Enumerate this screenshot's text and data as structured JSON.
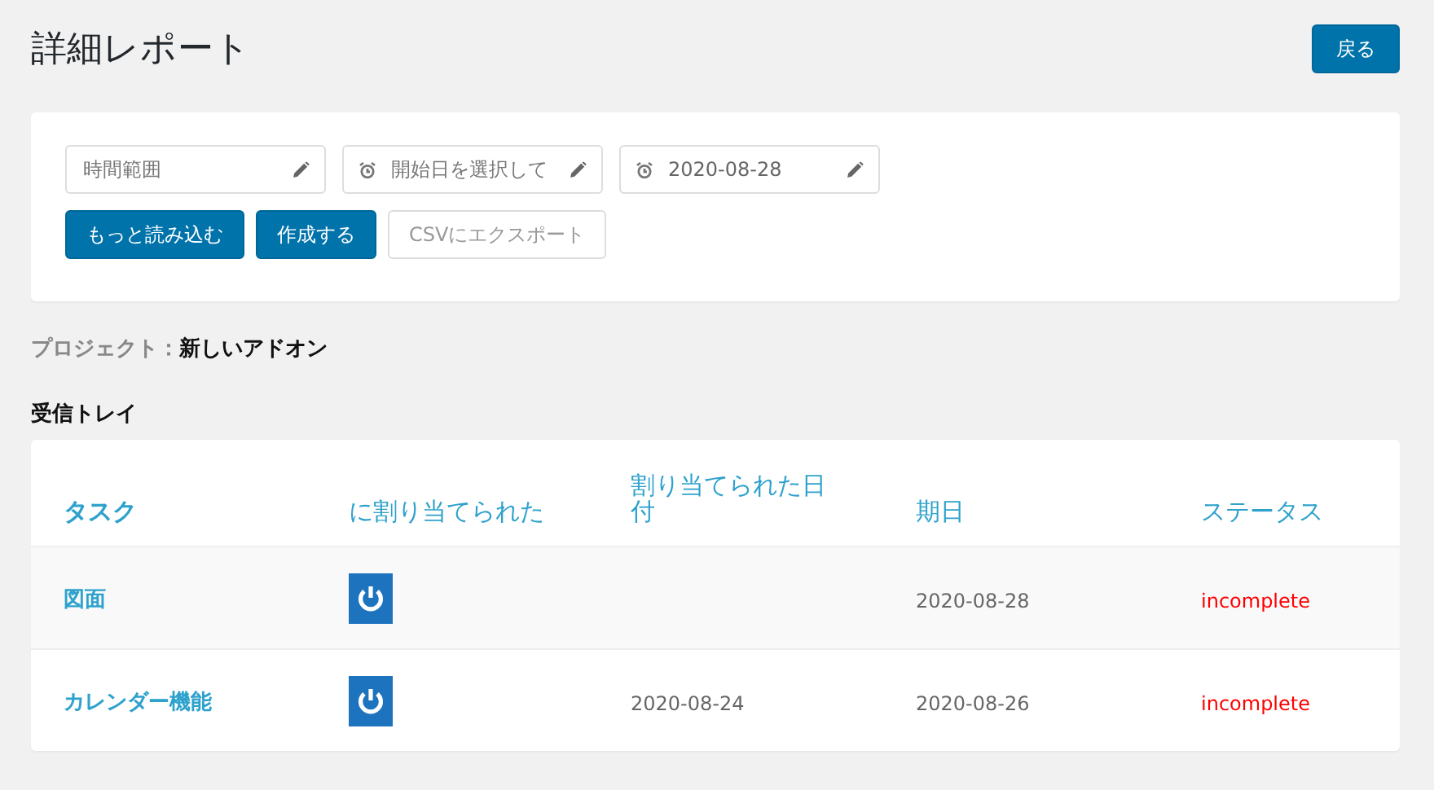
{
  "page": {
    "title": "詳細レポート",
    "back_button": "戻る"
  },
  "filters": {
    "fields": [
      {
        "kind": "text",
        "placeholder": "時間範囲"
      },
      {
        "kind": "date",
        "placeholder": "開始日を選択して"
      },
      {
        "kind": "date",
        "value": "2020-08-28"
      }
    ],
    "buttons": [
      {
        "label": "もっと読み込む",
        "primary": true
      },
      {
        "label": "作成する",
        "primary": true
      },
      {
        "label": "CSVにエクスポート",
        "primary": false
      }
    ]
  },
  "project": {
    "label": "プロジェクト：",
    "value": "新しいアドオン"
  },
  "section_title": "受信トレイ",
  "table": {
    "columns": [
      "タスク",
      "に割り当てられた",
      "割り当てられた日付",
      "期日",
      "ステータス"
    ],
    "rows": [
      {
        "task": "図面",
        "assigned_date": "",
        "due_date": "2020-08-28",
        "status": "incomplete"
      },
      {
        "task": "カレンダー機能",
        "assigned_date": "2020-08-24",
        "due_date": "2020-08-26",
        "status": "incomplete"
      }
    ]
  }
}
